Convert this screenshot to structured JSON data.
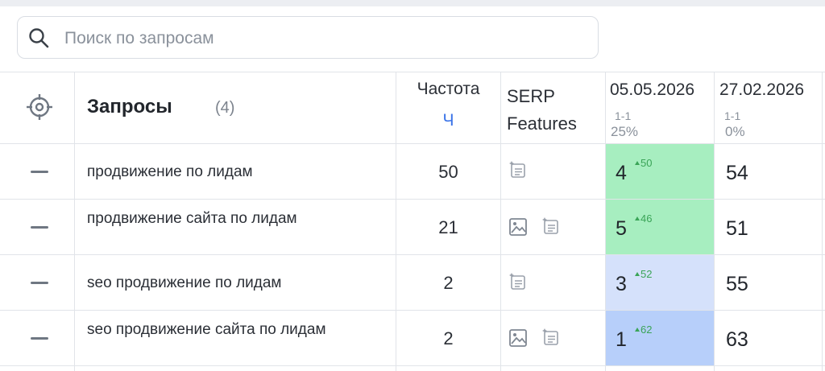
{
  "search": {
    "placeholder": "Поиск по запросам",
    "value": ""
  },
  "table": {
    "header": {
      "title": "Запросы",
      "count": "(4)",
      "frequency_label": "Частота",
      "frequency_sub": "Ч",
      "serp_line1": "SERP",
      "serp_line2": "Features",
      "dates": [
        {
          "date": "05.05.2026",
          "range": "1-1",
          "percent": "25%"
        },
        {
          "date": "27.02.2026",
          "range": "1-1",
          "percent": "0%"
        }
      ]
    },
    "rows": [
      {
        "query": "продвижение по лидам",
        "frequency": "50",
        "serp_icons": [
          "snippet-icon"
        ],
        "position": "4",
        "delta": "50",
        "previous": "54",
        "cell_color": "#a7eec0"
      },
      {
        "query": "продвижение сайта по лидам",
        "frequency": "21",
        "serp_icons": [
          "image-icon",
          "snippet-icon"
        ],
        "position": "5",
        "delta": "46",
        "previous": "51",
        "cell_color": "#a7eec0"
      },
      {
        "query": "seo продвижение по лидам",
        "frequency": "2",
        "serp_icons": [
          "snippet-icon"
        ],
        "position": "3",
        "delta": "52",
        "previous": "55",
        "cell_color": "#d5e1fb"
      },
      {
        "query": "seo продвижение сайта по лидам",
        "frequency": "2",
        "serp_icons": [
          "image-icon",
          "snippet-icon"
        ],
        "position": "1",
        "delta": "62",
        "previous": "63",
        "cell_color": "#b7cffa"
      }
    ]
  }
}
